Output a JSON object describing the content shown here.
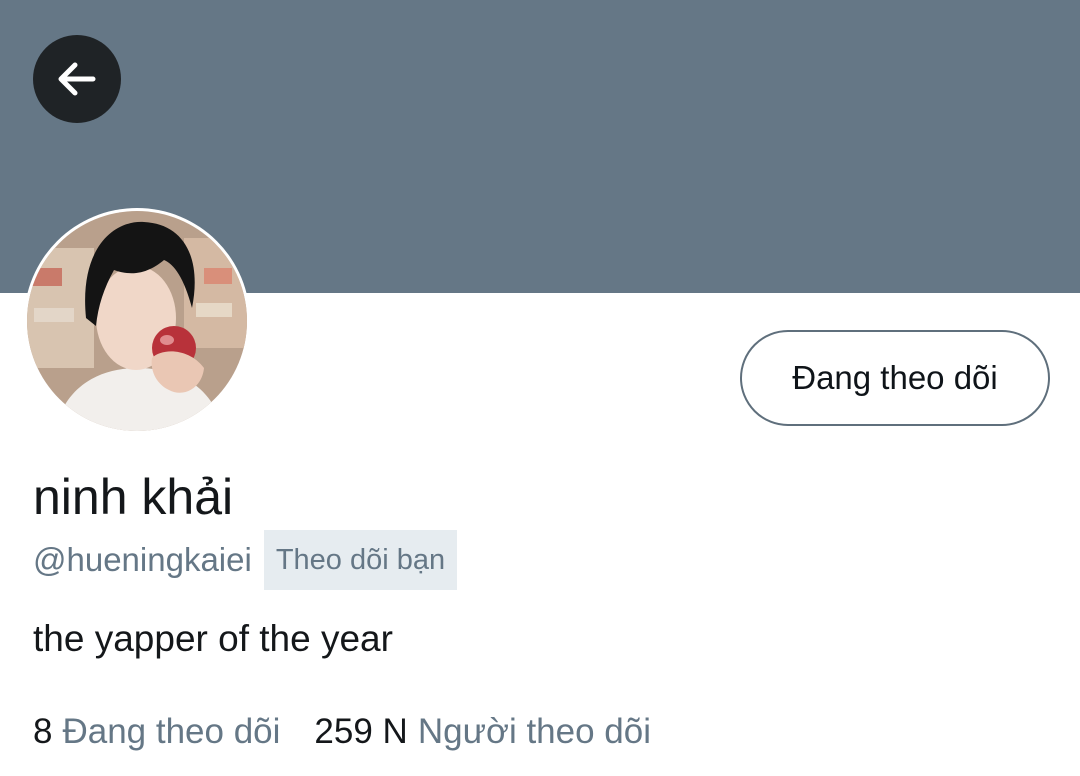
{
  "header": {
    "back_icon": "arrow-left-icon",
    "banner_color": "#657786"
  },
  "profile": {
    "avatar_icon": "profile-photo",
    "follow_button_label": "Đang theo dõi",
    "display_name": "ninh khải",
    "handle": "@hueningkaiei",
    "follows_you_badge": "Theo dõi bạn",
    "bio": "the yapper of the year"
  },
  "stats": {
    "following_count": "8",
    "following_label": "Đang theo dõi",
    "followers_count": "259 N",
    "followers_label": "Người theo dõi"
  }
}
